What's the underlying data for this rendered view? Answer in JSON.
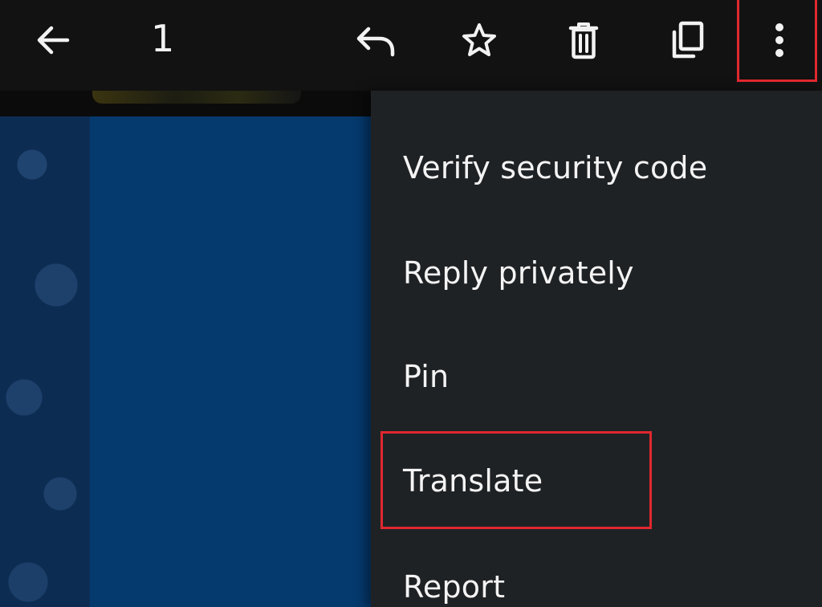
{
  "toolbar": {
    "selected_count": "1",
    "icons": {
      "back": "arrow-left-icon",
      "reply": "reply-icon",
      "star": "star-icon",
      "delete": "trash-icon",
      "copy": "copy-icon",
      "more": "more-vertical-icon"
    }
  },
  "menu": {
    "items": [
      {
        "label": "Verify security code"
      },
      {
        "label": "Reply privately"
      },
      {
        "label": "Pin"
      },
      {
        "label": "Translate"
      },
      {
        "label": "Report"
      }
    ]
  },
  "colors": {
    "toolbar_bg": "#121212",
    "menu_bg": "#1f2225",
    "chat_bg": "#0c2f58",
    "highlight": "#e0282f",
    "text": "#f4f4f4"
  }
}
